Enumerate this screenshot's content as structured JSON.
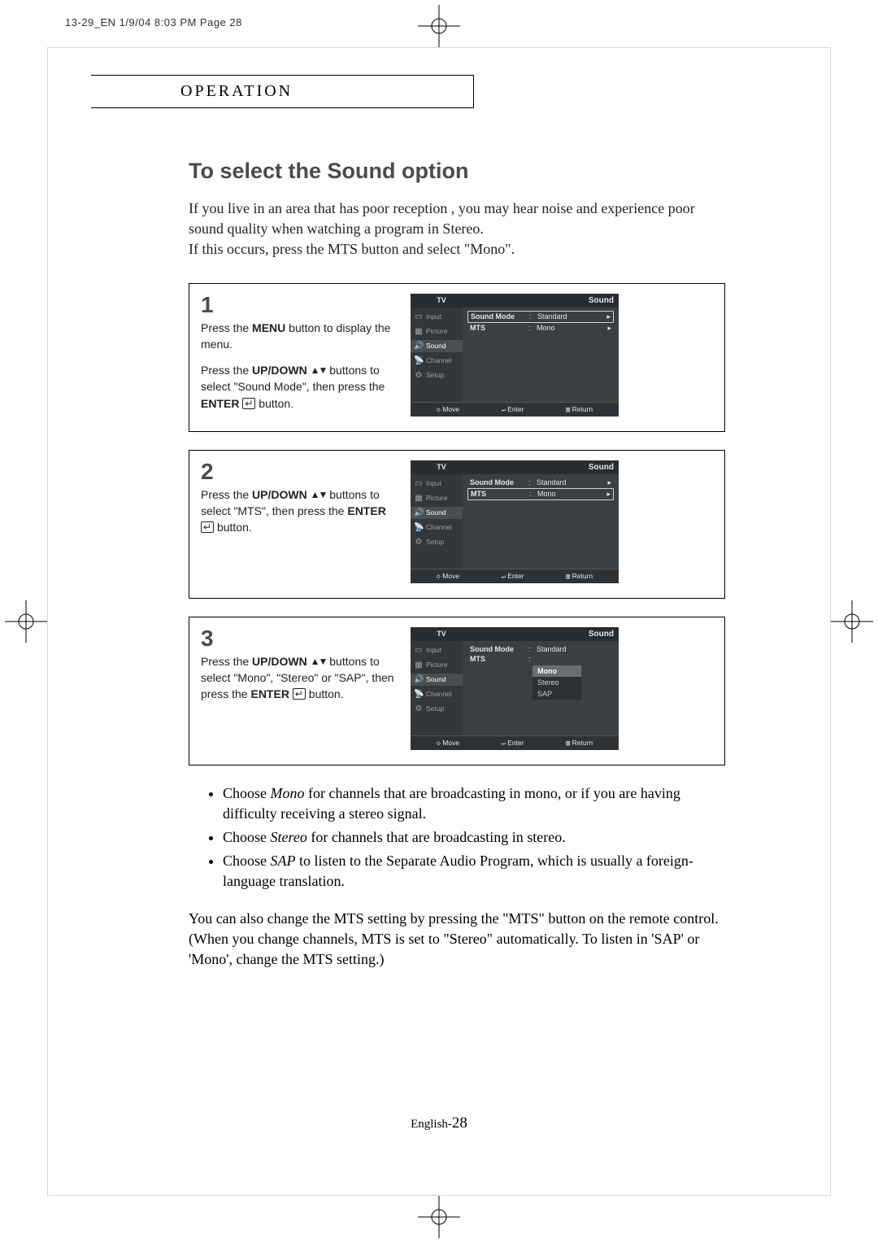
{
  "print_slug": "13-29_EN  1/9/04 8:03 PM  Page 28",
  "section_label": "OPERATION",
  "title": "To select the Sound option",
  "intro_line1": "If you live in an area that has poor reception , you may hear noise and experience poor sound quality when watching a program in Stereo.",
  "intro_line2": "If this occurs, press the MTS button and select \"Mono\".",
  "common": {
    "up_down_label": "UP/DOWN",
    "enter_label": "ENTER",
    "menu_label": "MENU"
  },
  "steps": {
    "s1": {
      "num": "1",
      "p1a": "Press the ",
      "p1b": " button to display the menu.",
      "p2a": "Press the ",
      "p2b": " buttons to select \"Sound Mode\", then press the ",
      "p2c": "  button."
    },
    "s2": {
      "num": "2",
      "p1a": "Press the ",
      "p1b": " buttons to select \"MTS\", then press the ",
      "p1c": "  button."
    },
    "s3": {
      "num": "3",
      "p1a": "Press the ",
      "p1b": " buttons to select \"Mono\", \"Stereo\" or \"SAP\", then press the ",
      "p1c": "  button."
    }
  },
  "osd": {
    "tv": "TV",
    "panel_title": "Sound",
    "nav": {
      "input": "Input",
      "picture": "Picture",
      "sound": "Sound",
      "channel": "Channel",
      "setup": "Setup"
    },
    "rows": {
      "sound_mode": {
        "label": "Sound Mode",
        "value": "Standard"
      },
      "mts": {
        "label": "MTS",
        "value": "Mono"
      }
    },
    "dropdown": {
      "mono": "Mono",
      "stereo": "Stereo",
      "sap": "SAP"
    },
    "footer": {
      "move": "Move",
      "enter": "Enter",
      "return": "Return"
    }
  },
  "bullets": {
    "b1a": "Choose ",
    "b1em": "Mono",
    "b1b": " for channels that are broadcasting in mono, or if you are having difficulty receiving a stereo signal.",
    "b2a": "Choose ",
    "b2em": "Stereo",
    "b2b": " for channels that are broadcasting in stereo.",
    "b3a": "Choose ",
    "b3em": "SAP",
    "b3b": " to listen to the Separate Audio Program, which is usually a foreign-language translation."
  },
  "closing_note": "You can also change the MTS setting by pressing the \"MTS\" button on the remote control. (When you change channels, MTS is set to \"Stereo\" automatically. To listen in 'SAP' or 'Mono', change the MTS setting.)",
  "footer_lang": "English-",
  "footer_page": "28"
}
